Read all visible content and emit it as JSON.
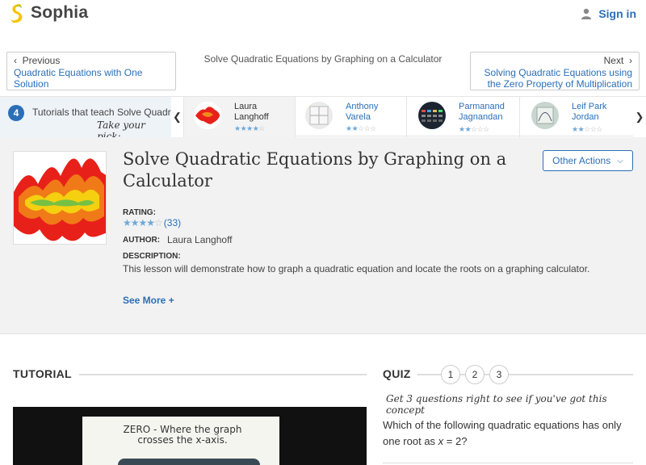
{
  "header": {
    "brand": "Sophia",
    "signin_label": "Sign in"
  },
  "nav": {
    "prev_dir": "Previous",
    "prev_title": "Quadratic Equations with One Solution",
    "current_title": "Solve Quadratic Equations by Graphing on a Calculator",
    "next_dir": "Next",
    "next_title": "Solving Quadratic Equations using the Zero Property of Multiplication"
  },
  "tutorials_strip": {
    "count": "4",
    "label": "Tutorials that teach Solve Quadratic Equations by Graphing on a Calculator",
    "pick": "Take your pick:",
    "items": [
      {
        "name": "Laura Langhoff",
        "rating": 4
      },
      {
        "name": "Anthony Varela",
        "rating": 2
      },
      {
        "name": "Parmanand Jagnandan",
        "rating": 2
      },
      {
        "name": "Leif Park Jordan",
        "rating": 2
      }
    ]
  },
  "lesson": {
    "title": "Solve Quadratic Equations by Graphing on a Calculator",
    "other_actions_label": "Other Actions",
    "rating_label": "RATING:",
    "rating_stars": 4,
    "rating_count": "(33)",
    "author_label": "AUTHOR:",
    "author": "Laura Langhoff",
    "description_label": "DESCRIPTION:",
    "description": "This lesson will demonstrate how to graph a quadratic equation and locate the roots on a graphing calculator.",
    "see_more": "See More +"
  },
  "tutorial_section": {
    "heading": "TUTORIAL",
    "video_text": "ZERO - Where the graph crosses the x-axis."
  },
  "quiz": {
    "heading": "QUIZ",
    "numbers": [
      "1",
      "2",
      "3"
    ],
    "hint": "Get 3 questions right to see if you've got this concept",
    "question_pre": "Which of the following quadratic equations has only one root as ",
    "question_var": "x",
    "question_post": " = 2?"
  },
  "colors": {
    "accent": "#2a6fb8",
    "brand_yellow": "#f5c400",
    "brand_green": "#7cc242",
    "lesson_bg": "#f2f2f2"
  }
}
